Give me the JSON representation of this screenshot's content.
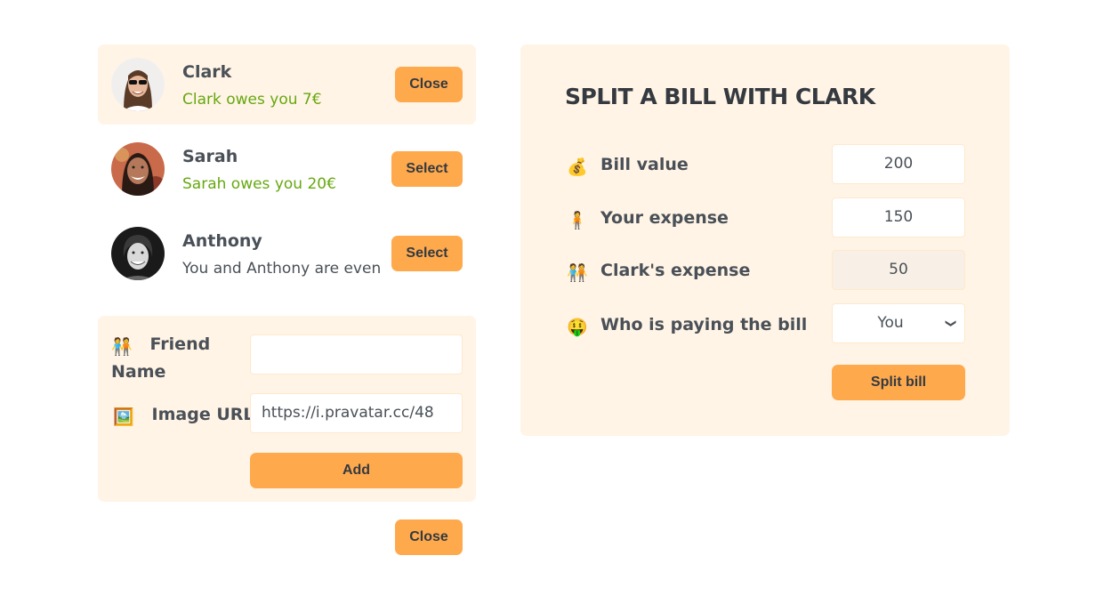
{
  "friends": [
    {
      "name": "Clark",
      "status": "Clark owes you 7€",
      "status_type": "green",
      "button": "Close",
      "selected": true
    },
    {
      "name": "Sarah",
      "status": "Sarah owes you 20€",
      "status_type": "green",
      "button": "Select",
      "selected": false
    },
    {
      "name": "Anthony",
      "status": "You and Anthony are even",
      "status_type": "even",
      "button": "Select",
      "selected": false
    }
  ],
  "add_form": {
    "name_emoji": "🧑‍🤝‍🧑",
    "name_label_1": "Friend",
    "name_label_2": "Name",
    "name_value": "",
    "image_emoji": "🖼️",
    "image_label": "Image URL",
    "image_value": "https://i.pravatar.cc/48",
    "add_button": "Add"
  },
  "bottom_close_button": "Close",
  "split": {
    "title": "SPLIT A BILL WITH CLARK",
    "bill_emoji": "💰",
    "bill_label": "Bill value",
    "bill_value": "200",
    "your_emoji": "🧍",
    "your_label": "Your expense",
    "your_value": "150",
    "friend_emoji": "🧑‍🤝‍🧑",
    "friend_label": "Clark's expense",
    "friend_value": "50",
    "payer_emoji": "🤑",
    "payer_label": "Who is paying the bill",
    "payer_value": "You",
    "submit_button": "Split bill"
  },
  "colors": {
    "accent": "#ffa94d",
    "panel_bg": "#fff4e6",
    "owed_text": "#66a80f",
    "text": "#495057"
  }
}
